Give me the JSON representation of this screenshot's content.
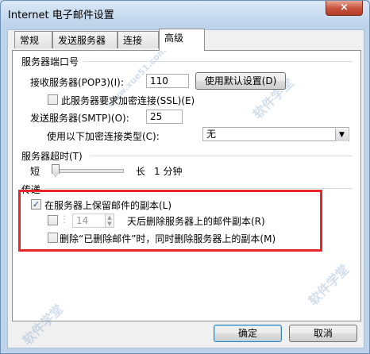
{
  "window": {
    "title": "Internet 电子邮件设置",
    "close_icon": "×"
  },
  "tabs": [
    {
      "label": "常规"
    },
    {
      "label": "发送服务器"
    },
    {
      "label": "连接"
    },
    {
      "label": "高级"
    }
  ],
  "ports": {
    "group_label": "服务器端口号",
    "incoming_label": "接收服务器(POP3)(I):",
    "incoming_value": "110",
    "default_button": "使用默认设置(D)",
    "ssl_label": "此服务器要求加密连接(SSL)(E)",
    "smtp_label": "发送服务器(SMTP)(O):",
    "smtp_value": "25",
    "encryption_label": "使用以下加密连接类型(C):",
    "encryption_value": "无"
  },
  "timeout": {
    "group_label": "服务器超时(T)",
    "short_label": "短",
    "long_label": "长",
    "value_text": "1 分钟"
  },
  "delivery": {
    "group_label": "传递",
    "leave_copy_label": "在服务器上保留邮件的副本(L)",
    "leave_copy_checked": "✓",
    "days_value": "14",
    "remove_after_label": "天后删除服务器上的邮件副本(R)",
    "remove_deleted_label": "删除“已删除邮件”时，同时删除服务器上的副本(M)"
  },
  "buttons": {
    "ok": "确定",
    "cancel": "取消"
  },
  "watermark": {
    "text": "软件学堂",
    "site": "www.xue51.com"
  },
  "colors": {
    "highlight_box": "#e5262a"
  }
}
